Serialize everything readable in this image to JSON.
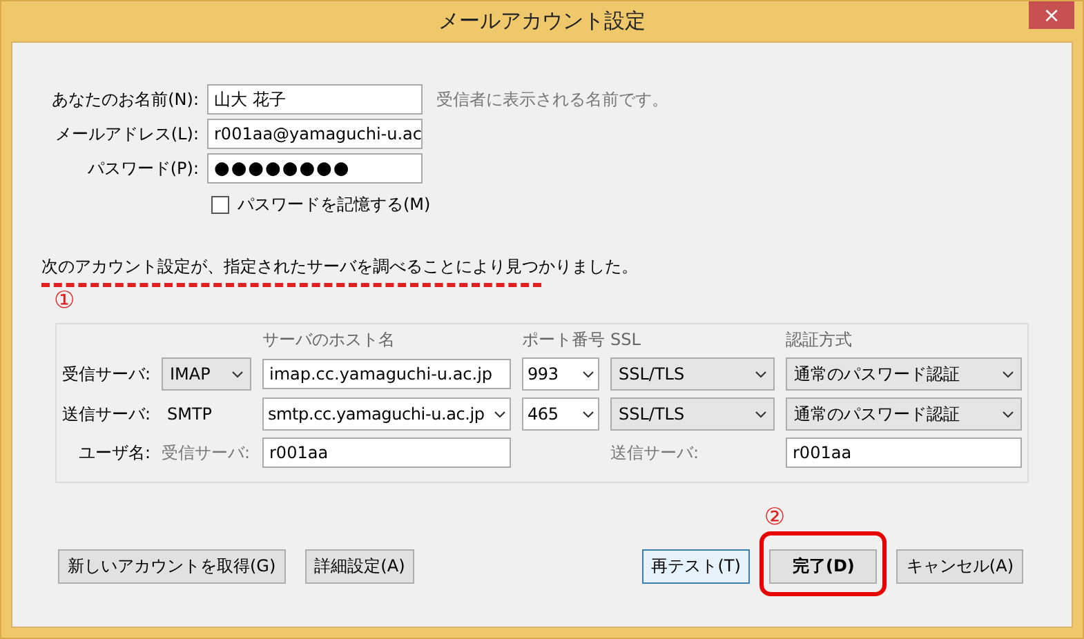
{
  "window": {
    "title": "メールアカウント設定",
    "close": "×"
  },
  "fields": [
    {
      "label": "あなたのお名前(N):",
      "value": "山大  花子",
      "kind": "text",
      "hint": "受信者に表示される名前です。"
    },
    {
      "label": "メールアドレス(L):",
      "value": "r001aa@yamaguchi-u.ac",
      "kind": "text"
    },
    {
      "label": "パスワード(P):",
      "value": "●●●●●●●●",
      "kind": "password"
    }
  ],
  "remember_password": {
    "label": "パスワードを記憶する(M)",
    "checked": false
  },
  "message": "次のアカウント設定が、指定されたサーバを調べることにより見つかりました。",
  "markers": [
    "①",
    "②"
  ],
  "servers": {
    "columns": [
      "サーバのホスト名",
      "ポート番号",
      "SSL",
      "認証方式"
    ],
    "rows": [
      {
        "label": "受信サーバ:",
        "protocol": {
          "kind": "select",
          "value": "IMAP"
        },
        "host": {
          "kind": "input",
          "value": "imap.cc.yamaguchi-u.ac.jp"
        },
        "port": "993",
        "ssl": "SSL/TLS",
        "auth": "通常のパスワード認証"
      },
      {
        "label": "送信サーバ:",
        "protocol": {
          "kind": "text",
          "value": "SMTP"
        },
        "host": {
          "kind": "select",
          "value": "smtp.cc.yamaguchi-u.ac.jp"
        },
        "port": "465",
        "ssl": "SSL/TLS",
        "auth": "通常のパスワード認証"
      }
    ],
    "username": {
      "label": "ユーザ名:",
      "incoming_label": "受信サーバ:",
      "incoming_value": "r001aa",
      "outgoing_label": "送信サーバ:",
      "outgoing_value": "r001aa"
    }
  },
  "buttons_left": [
    {
      "label": "新しいアカウントを取得(G)"
    },
    {
      "label": "詳細設定(A)"
    }
  ],
  "buttons_right": [
    {
      "label": "再テスト(T)",
      "focused": true,
      "default": false,
      "highlighted": false
    },
    {
      "label": "完了(D)",
      "focused": false,
      "default": true,
      "highlighted": true
    },
    {
      "label": "キャンセル(A)",
      "focused": false,
      "default": false,
      "highlighted": false
    }
  ]
}
